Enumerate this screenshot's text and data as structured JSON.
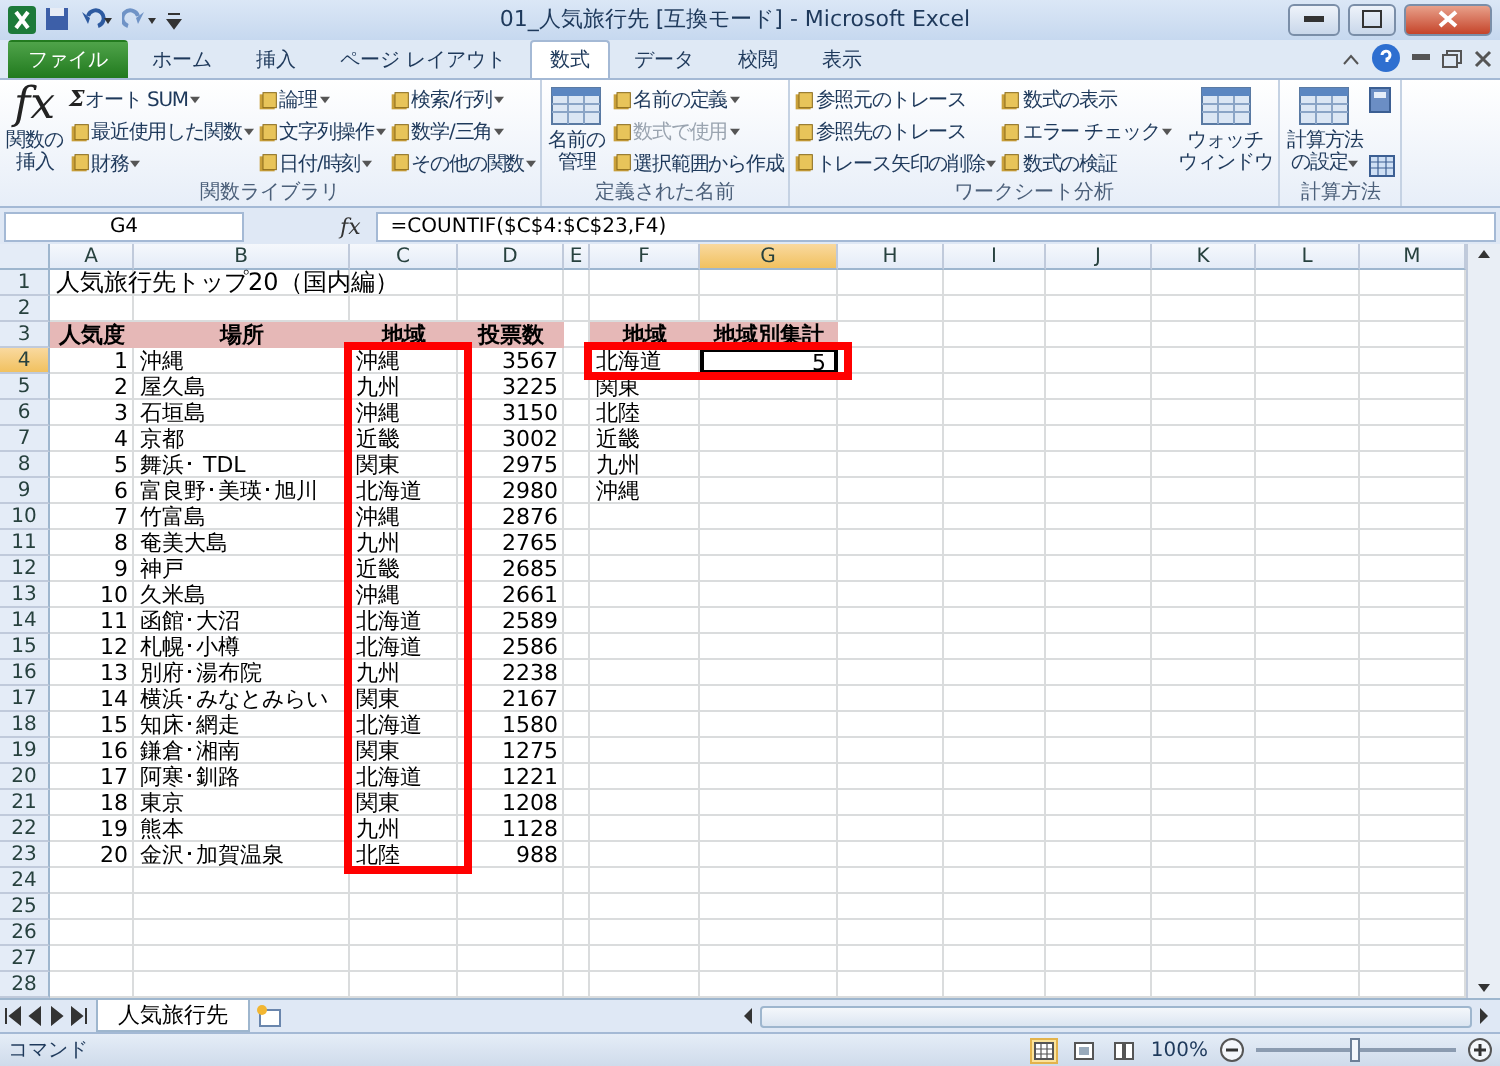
{
  "window": {
    "title": "01_人気旅行先  [互換モード] - Microsoft Excel"
  },
  "ribbon_tabs": [
    {
      "label": "ファイル",
      "kind": "file",
      "selected": false
    },
    {
      "label": "ホーム",
      "kind": "tab",
      "selected": false
    },
    {
      "label": "挿入",
      "kind": "tab",
      "selected": false
    },
    {
      "label": "ページ レイアウト",
      "kind": "tab",
      "selected": false
    },
    {
      "label": "数式",
      "kind": "tab",
      "selected": true
    },
    {
      "label": "データ",
      "kind": "tab",
      "selected": false
    },
    {
      "label": "校閲",
      "kind": "tab",
      "selected": false
    },
    {
      "label": "表示",
      "kind": "tab",
      "selected": false
    }
  ],
  "ribbon_groups": [
    {
      "label": "関数ライブラリ",
      "items": [
        {
          "kind": "large",
          "glyph": "fx",
          "lines": [
            "関数の",
            "挿入"
          ],
          "dropdown": false
        },
        {
          "kind": "stack",
          "entries": [
            {
              "label": "オート SUM",
              "glyph": "Σ",
              "dropdown": true,
              "disabled": false
            },
            {
              "label": "最近使用した関数",
              "dropdown": true,
              "disabled": false
            },
            {
              "label": "財務",
              "dropdown": true,
              "disabled": false
            }
          ]
        },
        {
          "kind": "stack",
          "entries": [
            {
              "label": "論理",
              "dropdown": true,
              "disabled": false
            },
            {
              "label": "文字列操作",
              "dropdown": true,
              "disabled": false
            },
            {
              "label": "日付/時刻",
              "dropdown": true,
              "disabled": false
            }
          ]
        },
        {
          "kind": "stack",
          "entries": [
            {
              "label": "検索/行列",
              "dropdown": true,
              "disabled": false
            },
            {
              "label": "数学/三角",
              "dropdown": true,
              "disabled": false
            },
            {
              "label": "その他の関数",
              "dropdown": true,
              "disabled": false
            }
          ]
        }
      ]
    },
    {
      "label": "定義された名前",
      "items": [
        {
          "kind": "large",
          "lines": [
            "名前の",
            "管理"
          ],
          "dropdown": false
        },
        {
          "kind": "stack",
          "entries": [
            {
              "label": "名前の定義",
              "dropdown": true,
              "disabled": false
            },
            {
              "label": "数式で使用",
              "dropdown": true,
              "disabled": true
            },
            {
              "label": "選択範囲から作成",
              "dropdown": false,
              "disabled": false
            }
          ]
        }
      ]
    },
    {
      "label": "ワークシート分析",
      "items": [
        {
          "kind": "stack",
          "entries": [
            {
              "label": "参照元のトレース",
              "dropdown": false,
              "disabled": false
            },
            {
              "label": "参照先のトレース",
              "dropdown": false,
              "disabled": false
            },
            {
              "label": "トレース矢印の削除",
              "dropdown": true,
              "disabled": false
            }
          ]
        },
        {
          "kind": "stack",
          "entries": [
            {
              "label": "数式の表示",
              "dropdown": false,
              "disabled": false
            },
            {
              "label": "エラー チェック",
              "dropdown": true,
              "disabled": false
            },
            {
              "label": "数式の検証",
              "dropdown": false,
              "disabled": false
            }
          ]
        },
        {
          "kind": "large",
          "lines": [
            "ウォッチ",
            "ウィンドウ"
          ],
          "dropdown": false
        }
      ]
    },
    {
      "label": "計算方法",
      "items": [
        {
          "kind": "large",
          "lines": [
            "計算方法",
            "の設定"
          ],
          "dropdown": true
        },
        {
          "kind": "icons"
        }
      ]
    }
  ],
  "formula_bar": {
    "name_box": "G4",
    "fx": "fx",
    "formula": "=COUNTIF($C$4:$C$23,F4)"
  },
  "columns": [
    {
      "label": "A",
      "selected": false
    },
    {
      "label": "B",
      "selected": false
    },
    {
      "label": "C",
      "selected": false
    },
    {
      "label": "D",
      "selected": false
    },
    {
      "label": "E",
      "selected": false
    },
    {
      "label": "F",
      "selected": false
    },
    {
      "label": "G",
      "selected": true
    },
    {
      "label": "H",
      "selected": false
    },
    {
      "label": "I",
      "selected": false
    },
    {
      "label": "J",
      "selected": false
    },
    {
      "label": "K",
      "selected": false
    },
    {
      "label": "L",
      "selected": false
    },
    {
      "label": "M",
      "selected": false
    }
  ],
  "rows": [
    {
      "number": "1",
      "selected": false
    },
    {
      "number": "2",
      "selected": false
    },
    {
      "number": "3",
      "selected": false
    },
    {
      "number": "4",
      "selected": true
    },
    {
      "number": "5",
      "selected": false
    },
    {
      "number": "6",
      "selected": false
    },
    {
      "number": "7",
      "selected": false
    },
    {
      "number": "8",
      "selected": false
    },
    {
      "number": "9",
      "selected": false
    },
    {
      "number": "10",
      "selected": false
    },
    {
      "number": "11",
      "selected": false
    },
    {
      "number": "12",
      "selected": false
    },
    {
      "number": "13",
      "selected": false
    },
    {
      "number": "14",
      "selected": false
    },
    {
      "number": "15",
      "selected": false
    },
    {
      "number": "16",
      "selected": false
    },
    {
      "number": "17",
      "selected": false
    },
    {
      "number": "18",
      "selected": false
    },
    {
      "number": "19",
      "selected": false
    },
    {
      "number": "20",
      "selected": false
    },
    {
      "number": "21",
      "selected": false
    },
    {
      "number": "22",
      "selected": false
    },
    {
      "number": "23",
      "selected": false
    },
    {
      "number": "24",
      "selected": false
    },
    {
      "number": "25",
      "selected": false
    },
    {
      "number": "26",
      "selected": false
    },
    {
      "number": "27",
      "selected": false
    },
    {
      "number": "28",
      "selected": false
    }
  ],
  "sheet_title": "人気旅行先トップ20（国内編）",
  "ranking_table": {
    "region_column_outlined": true,
    "rows": [
      [
        "人気度",
        "場所",
        "地域",
        "投票数"
      ],
      [
        "1",
        "沖縄",
        "沖縄",
        "3567"
      ],
      [
        "2",
        "屋久島",
        "九州",
        "3225"
      ],
      [
        "3",
        "石垣島",
        "沖縄",
        "3150"
      ],
      [
        "4",
        "京都",
        "近畿",
        "3002"
      ],
      [
        "5",
        "舞浜･ TDL",
        "関東",
        "2975"
      ],
      [
        "6",
        "富良野･美瑛･旭川",
        "北海道",
        "2980"
      ],
      [
        "7",
        "竹富島",
        "沖縄",
        "2876"
      ],
      [
        "8",
        "奄美大島",
        "九州",
        "2765"
      ],
      [
        "9",
        "神戸",
        "近畿",
        "2685"
      ],
      [
        "10",
        "久米島",
        "沖縄",
        "2661"
      ],
      [
        "11",
        "函館･大沼",
        "北海道",
        "2589"
      ],
      [
        "12",
        "札幌･小樽",
        "北海道",
        "2586"
      ],
      [
        "13",
        "別府･湯布院",
        "九州",
        "2238"
      ],
      [
        "14",
        "横浜･みなとみらい",
        "関東",
        "2167"
      ],
      [
        "15",
        "知床･網走",
        "北海道",
        "1580"
      ],
      [
        "16",
        "鎌倉･湘南",
        "関東",
        "1275"
      ],
      [
        "17",
        "阿寒･釧路",
        "北海道",
        "1221"
      ],
      [
        "18",
        "東京",
        "関東",
        "1208"
      ],
      [
        "19",
        "熊本",
        "九州",
        "1128"
      ],
      [
        "20",
        "金沢･加賀温泉",
        "北陸",
        "988"
      ]
    ]
  },
  "summary_table": {
    "first_row_outlined": true,
    "rows": [
      [
        "地域",
        "地域別集計"
      ],
      [
        "北海道",
        "5"
      ],
      [
        "関東"
      ],
      [
        "北陸"
      ],
      [
        "近畿"
      ],
      [
        "九州"
      ],
      [
        "沖縄"
      ]
    ]
  },
  "sheet_tabs": [
    {
      "label": "人気旅行先",
      "selected": true
    }
  ],
  "status_bar": {
    "mode": "コマンド",
    "views": [
      {
        "kind": "normal",
        "selected": true
      },
      {
        "kind": "layout",
        "selected": false
      },
      {
        "kind": "pagebreak",
        "selected": false
      }
    ],
    "zoom": "100%",
    "zoom_level": {
      "level": 0.5
    }
  }
}
